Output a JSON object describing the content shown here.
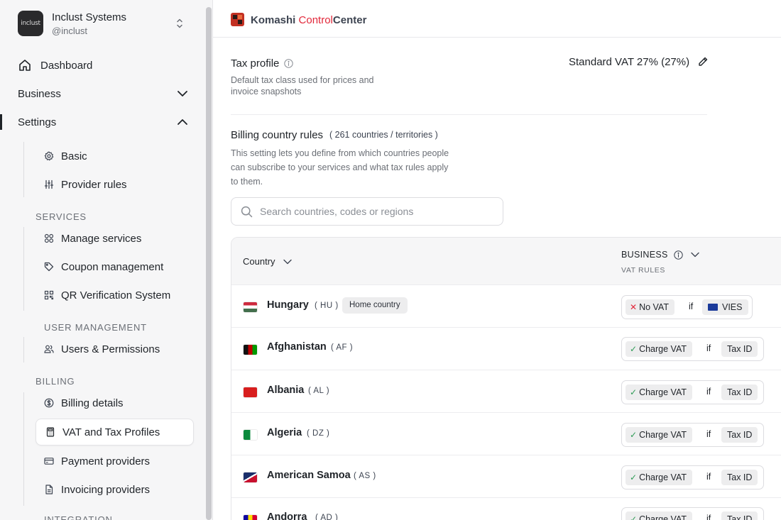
{
  "sidebar": {
    "org_name": "Inclust Systems",
    "org_handle": "@inclust",
    "org_logo_text": "inclust",
    "dashboard_label": "Dashboard",
    "business_label": "Business",
    "settings_label": "Settings",
    "basic_label": "Basic",
    "provider_rules_label": "Provider rules",
    "services_section": "SERVICES",
    "manage_services_label": "Manage services",
    "coupon_management_label": "Coupon management",
    "qr_verification_label": "QR Verification System",
    "user_management_section": "USER MANAGEMENT",
    "users_permissions_label": "Users & Permissions",
    "billing_section": "BILLING",
    "billing_details_label": "Billing details",
    "vat_tax_profiles_label": "VAT and Tax Profiles",
    "payment_providers_label": "Payment providers",
    "invoicing_providers_label": "Invoicing providers",
    "integration_section": "INTEGRATION"
  },
  "header": {
    "brand_part1": "Komashi",
    "brand_part2": "Control",
    "brand_part3": "Center",
    "accent_color": "#e2283a"
  },
  "tax_profile": {
    "title": "Tax profile",
    "description": "Default tax class used for prices and invoice snapshots",
    "value": "Standard VAT 27% (27%)"
  },
  "billing_rules": {
    "title": "Billing country rules",
    "count": "( 261 countries / territories )",
    "description": "This setting lets you define from which countries people can subscribe to your services and what tax rules apply to them.",
    "search_placeholder": "Search countries, codes or regions"
  },
  "table": {
    "col_country": "Country",
    "col_business": "BUSINESS",
    "col_business_sub": "VAT RULES",
    "home_badge": "Home country",
    "if_label": "if",
    "rows": [
      {
        "name": "Hungary",
        "code": "( HU )",
        "rule": "No VAT",
        "condition": "VIES"
      },
      {
        "name": "Afghanistan",
        "code": "( AF )",
        "rule": "Charge VAT",
        "condition": "Tax ID"
      },
      {
        "name": "Albania",
        "code": "( AL )",
        "rule": "Charge VAT",
        "condition": "Tax ID"
      },
      {
        "name": "Algeria",
        "code": "( DZ )",
        "rule": "Charge VAT",
        "condition": "Tax ID"
      },
      {
        "name": "American Samoa",
        "code": "( AS )",
        "rule": "Charge VAT",
        "condition": "Tax ID"
      },
      {
        "name": "Andorra",
        "code": "( AD )",
        "rule": "Charge VAT",
        "condition": "Tax ID"
      }
    ]
  }
}
